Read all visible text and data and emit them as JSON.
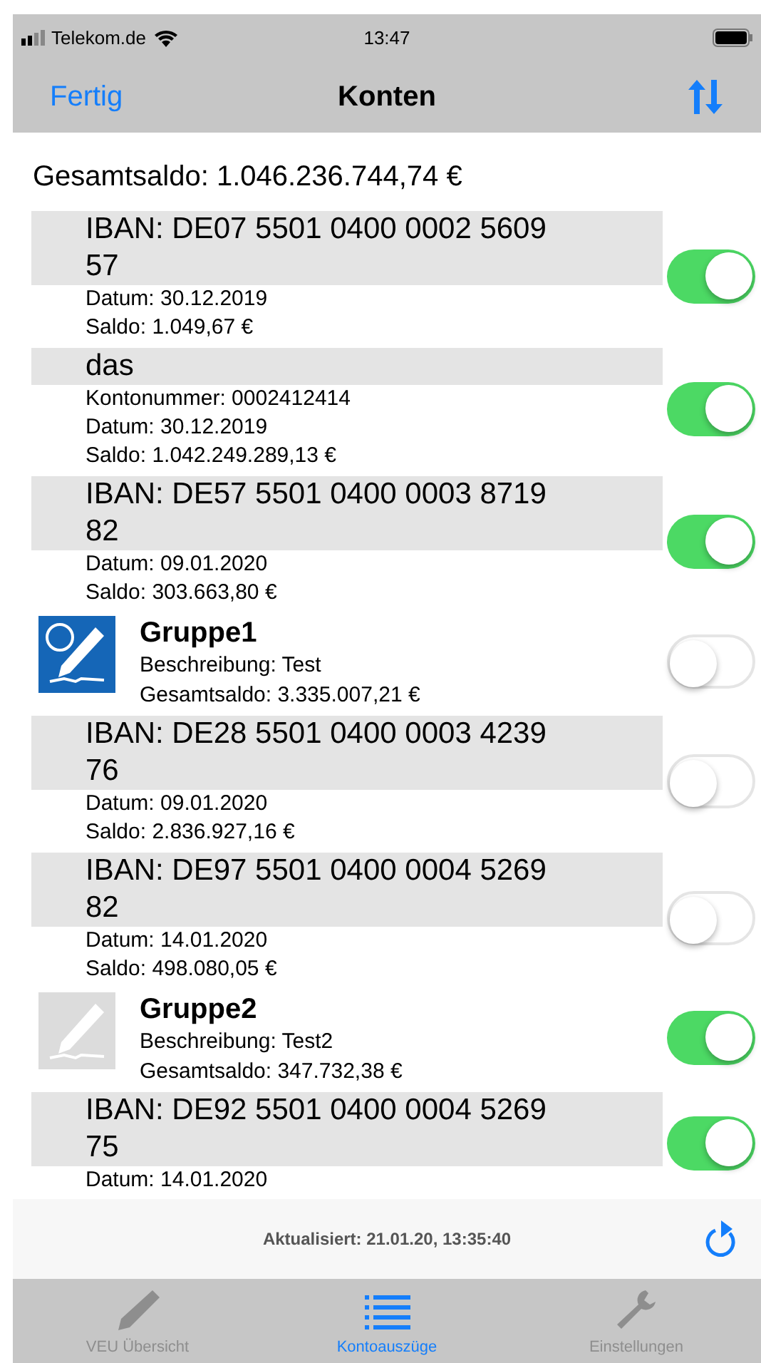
{
  "status_bar": {
    "carrier": "Telekom.de",
    "time": "13:47"
  },
  "nav": {
    "left_button": "Fertig",
    "title": "Konten"
  },
  "total": "Gesamtsaldo: 1.046.236.744,74 €",
  "items": [
    {
      "kind": "account",
      "title": "IBAN: DE07 5501 0400 0002 5609 57",
      "lines": [
        "Datum: 30.12.2019",
        "Saldo: 1.049,67 €"
      ],
      "on": true
    },
    {
      "kind": "account",
      "title": "das",
      "lines": [
        "Kontonummer: 0002412414",
        "Datum: 30.12.2019",
        "Saldo: 1.042.249.289,13 €"
      ],
      "on": true
    },
    {
      "kind": "account",
      "title": "IBAN: DE57 5501 0400 0003 8719 82",
      "lines": [
        "Datum: 09.01.2020",
        "Saldo: 303.663,80 €"
      ],
      "on": true
    },
    {
      "kind": "group",
      "title": "Gruppe1",
      "lines": [
        "Beschreibung: Test",
        "Gesamtsaldo: 3.335.007,21 €"
      ],
      "icon_active": true,
      "on": false
    },
    {
      "kind": "account",
      "title": "IBAN: DE28 5501 0400 0003 4239 76",
      "lines": [
        "Datum: 09.01.2020",
        "Saldo: 2.836.927,16 €"
      ],
      "on": false
    },
    {
      "kind": "account",
      "title": "IBAN: DE97 5501 0400 0004 5269 82",
      "lines": [
        "Datum: 14.01.2020",
        "Saldo: 498.080,05 €"
      ],
      "on": false
    },
    {
      "kind": "group",
      "title": "Gruppe2",
      "lines": [
        "Beschreibung: Test2",
        "Gesamtsaldo: 347.732,38 €"
      ],
      "icon_active": false,
      "on": true
    },
    {
      "kind": "account",
      "title": "IBAN: DE92 5501 0400 0004 5269 75",
      "lines": [
        "Datum: 14.01.2020"
      ],
      "on": true
    }
  ],
  "footer": {
    "updated": "Aktualisiert: 21.01.20, 13:35:40"
  },
  "tabs": [
    {
      "label": "VEU Übersicht",
      "kind": "pencil",
      "selected": false
    },
    {
      "label": "Kontoauszüge",
      "kind": "list",
      "selected": true
    },
    {
      "label": "Einstellungen",
      "kind": "wrench",
      "selected": false
    }
  ]
}
